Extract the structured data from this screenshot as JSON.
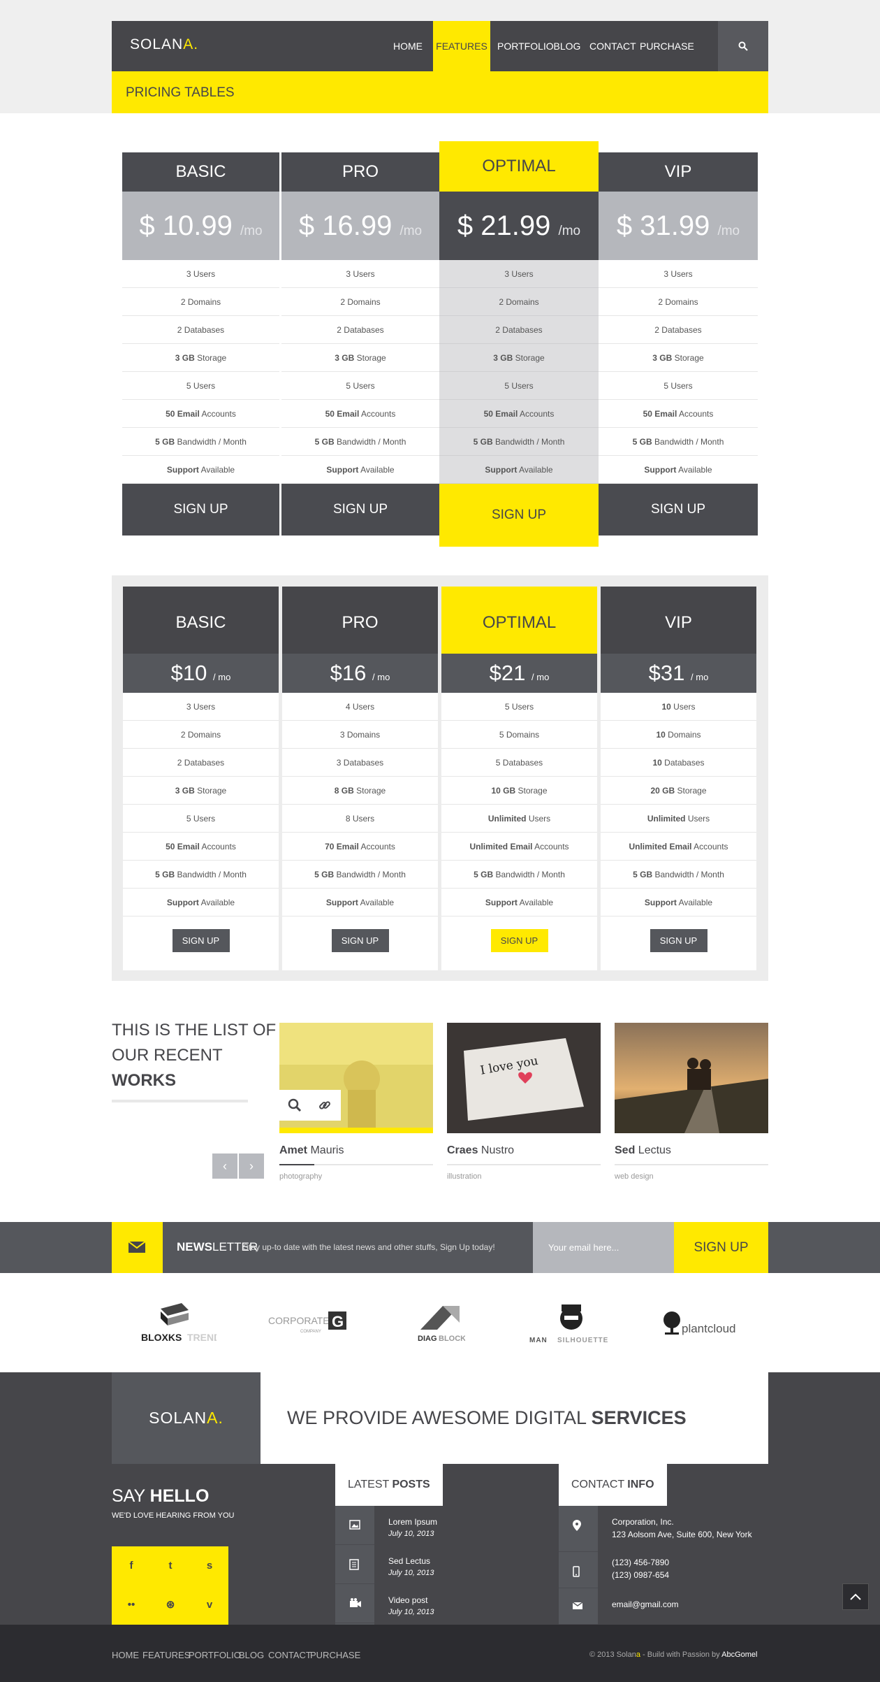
{
  "brand": {
    "name": "SOLAN",
    "accent": "A."
  },
  "nav": [
    "HOME",
    "FEATURES",
    "PORTFOLIO",
    "BLOG",
    "CONTACT",
    "PURCHASE"
  ],
  "page_title": "PRICING TABLES",
  "table1": {
    "cols": [
      {
        "name": "BASIC",
        "price": "$ 10.99",
        "per": "/mo"
      },
      {
        "name": "PRO",
        "price": "$ 16.99",
        "per": "/mo"
      },
      {
        "name": "OPTIMAL",
        "price": "$ 21.99",
        "per": "/mo"
      },
      {
        "name": "VIP",
        "price": "$ 31.99",
        "per": "/mo"
      }
    ],
    "features": [
      {
        "b": "",
        "t": "3 Users"
      },
      {
        "b": "",
        "t": "2 Domains"
      },
      {
        "b": "",
        "t": "2 Databases"
      },
      {
        "b": "3 GB",
        "t": " Storage"
      },
      {
        "b": "",
        "t": "5 Users"
      },
      {
        "b": "50 Email",
        "t": " Accounts"
      },
      {
        "b": "5 GB",
        "t": " Bandwidth / Month"
      },
      {
        "b": "Support",
        "t": " Available"
      }
    ],
    "signup": "SIGN UP"
  },
  "table2": {
    "cols": [
      {
        "name": "BASIC",
        "price": "$10",
        "per": "/ mo",
        "features": [
          [
            "",
            "3 Users"
          ],
          [
            "",
            "2 Domains"
          ],
          [
            "",
            "2 Databases"
          ],
          [
            "3 GB",
            " Storage"
          ],
          [
            "",
            "5 Users"
          ],
          [
            "50 Email",
            " Accounts"
          ],
          [
            "5 GB",
            " Bandwidth / Month"
          ],
          [
            "Support",
            " Available"
          ]
        ]
      },
      {
        "name": "PRO",
        "price": "$16",
        "per": "/ mo",
        "features": [
          [
            "",
            "4 Users"
          ],
          [
            "",
            "3 Domains"
          ],
          [
            "",
            "3 Databases"
          ],
          [
            "8 GB",
            " Storage"
          ],
          [
            "",
            "8 Users"
          ],
          [
            "70 Email",
            " Accounts"
          ],
          [
            "5 GB",
            " Bandwidth / Month"
          ],
          [
            "Support",
            " Available"
          ]
        ]
      },
      {
        "name": "OPTIMAL",
        "price": "$21",
        "per": "/ mo",
        "features": [
          [
            "",
            "5 Users"
          ],
          [
            "",
            "5 Domains"
          ],
          [
            "",
            "5 Databases"
          ],
          [
            "10 GB",
            " Storage"
          ],
          [
            "Unlimited",
            " Users"
          ],
          [
            "Unlimited Email",
            " Accounts"
          ],
          [
            "5 GB",
            " Bandwidth / Month"
          ],
          [
            "Support",
            " Available"
          ]
        ]
      },
      {
        "name": "VIP",
        "price": "$31",
        "per": "/ mo",
        "features": [
          [
            "10",
            " Users"
          ],
          [
            "10",
            " Domains"
          ],
          [
            "10",
            " Databases"
          ],
          [
            "20 GB",
            " Storage"
          ],
          [
            "Unlimited",
            " Users"
          ],
          [
            "Unlimited Email",
            " Accounts"
          ],
          [
            "5 GB",
            " Bandwidth / Month"
          ],
          [
            "Support",
            " Available"
          ]
        ]
      }
    ],
    "signup": "SIGN UP"
  },
  "works": {
    "title_l1": "THIS IS THE LIST OF",
    "title_l2": "OUR RECENT",
    "title_l3": "WORKS",
    "prev": "‹",
    "next": "›",
    "items": [
      {
        "bold": "Amet",
        "rest": " Mauris",
        "cat": "photography"
      },
      {
        "bold": "Craes",
        "rest": " Nustro",
        "cat": "illustration",
        "note": "I love you"
      },
      {
        "bold": "Sed",
        "rest": " Lectus",
        "cat": "web design"
      }
    ]
  },
  "newsletter": {
    "title_b": "NEWS",
    "title_r": "LETTER",
    "text": "Stay up-to date with the latest news and other stuffs, Sign Up today!",
    "placeholder": "Your email here...",
    "button": "SIGN UP"
  },
  "clients": [
    {
      "a": "BLOXKS",
      "b": "TREND"
    },
    {
      "a": "CORPORATE",
      "b": "COMPANY"
    },
    {
      "a": "DIAG",
      "b": "BLOCK"
    },
    {
      "a": "MAN",
      "b": "SILHOUETTE"
    },
    {
      "a": "plantcloud",
      "b": ""
    }
  ],
  "footer": {
    "logo": "SOLAN",
    "logo_accent": "A.",
    "tagline_r": "WE PROVIDE AWESOME DIGITAL ",
    "tagline_b": "SERVICES",
    "say": "SAY ",
    "hello": "HELLO",
    "love": "WE'D LOVE HEARING FROM YOU",
    "social": [
      "f",
      "t",
      "s",
      "••",
      "⊛",
      "v"
    ],
    "posts_r": "LATEST ",
    "posts_b": "POSTS",
    "posts": [
      {
        "title": "Lorem Ipsum",
        "date": "July 10, 2013"
      },
      {
        "title": "Sed Lectus",
        "date": "July 10, 2013"
      },
      {
        "title": "Video post",
        "date": "July 10, 2013"
      }
    ],
    "contact_r": "CONTACT ",
    "contact_b": "INFO",
    "address1": "Corporation, Inc.",
    "address2": "123 Aolsom Ave, Suite 600, New York",
    "phone1": "(123) 456-7890",
    "phone2": "(123) 0987-654",
    "email": "email@gmail.com"
  },
  "bottom": {
    "nav": [
      "HOME",
      "FEATURES",
      "PORTFOLIO",
      "BLOG",
      "CONTACT",
      "PURCHASE"
    ],
    "copy_a": "© 2013 Solan",
    "copy_y": "a",
    "copy_b": " - Build with Passion by ",
    "copy_w": "AbcGomel"
  }
}
